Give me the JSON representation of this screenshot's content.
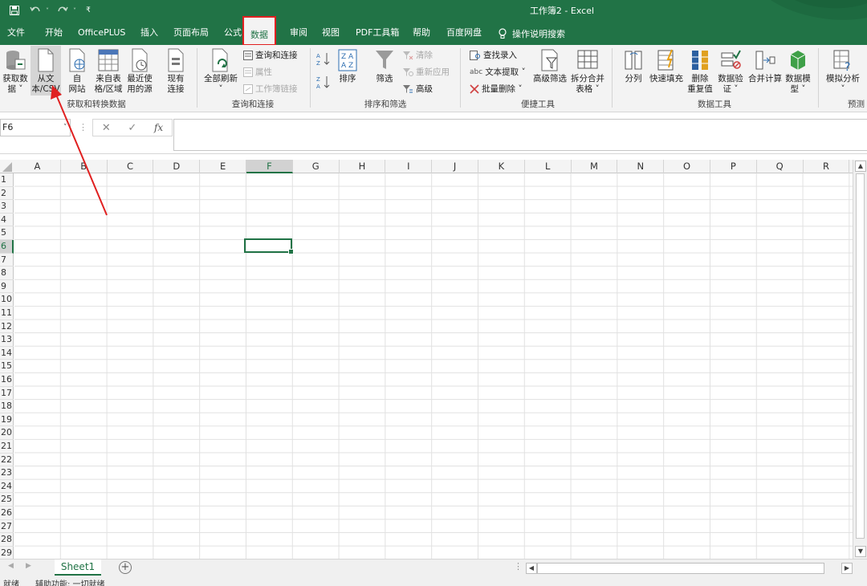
{
  "window": {
    "title": "工作簿2 - Excel",
    "accent": "#217346",
    "highlight": "#e02020"
  },
  "quick_access": [
    "save-icon",
    "undo-icon",
    "redo-icon",
    "customize-icon"
  ],
  "tabs": [
    {
      "label": "文件"
    },
    {
      "label": "开始"
    },
    {
      "label": "OfficePLUS"
    },
    {
      "label": "插入"
    },
    {
      "label": "页面布局"
    },
    {
      "label": "公式"
    },
    {
      "label": "数据",
      "active": true
    },
    {
      "label": "审阅"
    },
    {
      "label": "视图"
    },
    {
      "label": "PDF工具箱"
    },
    {
      "label": "帮助"
    },
    {
      "label": "百度网盘"
    }
  ],
  "tell_me": "操作说明搜索",
  "ribbon": {
    "get_transform": {
      "label": "获取和转换数据",
      "get_data": [
        "获取数",
        "据 ˅"
      ],
      "from_text": [
        "从文",
        "本/CSV"
      ],
      "from_web": [
        "自",
        "网站"
      ],
      "from_table": [
        "来自表",
        "格/区域"
      ],
      "recent": [
        "最近使",
        "用的源"
      ],
      "existing": [
        "现有",
        "连接"
      ]
    },
    "queries": {
      "label": "查询和连接",
      "refresh_all": [
        "全部刷新",
        "˅"
      ],
      "queries_connections": "查询和连接",
      "properties": "属性",
      "workbook_links": "工作簿链接"
    },
    "sort_filter": {
      "label": "排序和筛选",
      "sort": "排序",
      "filter": "筛选",
      "clear": "清除",
      "reapply": "重新应用",
      "advanced": "高级"
    },
    "quick_tools": {
      "label": "便捷工具",
      "find_entry": "查找录入",
      "text_extract": "文本提取 ˅",
      "batch_delete": "批量删除 ˅",
      "advanced_filter": "高级筛选",
      "split_merge": [
        "拆分合并",
        "表格 ˅"
      ]
    },
    "data_tools": {
      "label": "数据工具",
      "text_to_columns": "分列",
      "flash_fill": "快速填充",
      "remove_dup": [
        "删除",
        "重复值"
      ],
      "validation": [
        "数据验",
        "证 ˅"
      ],
      "consolidate": "合并计算",
      "data_model": [
        "数据模",
        "型 ˅"
      ]
    },
    "forecast": {
      "label": "预测",
      "what_if": [
        "模拟分析",
        "˅"
      ]
    }
  },
  "formula_bar": {
    "name_box": "F6",
    "fx": "fx",
    "value": ""
  },
  "columns": [
    "A",
    "B",
    "C",
    "D",
    "E",
    "F",
    "G",
    "H",
    "I",
    "J",
    "K",
    "L",
    "M",
    "N",
    "O",
    "P",
    "Q",
    "R"
  ],
  "rows": [
    "1",
    "2",
    "3",
    "4",
    "5",
    "6",
    "7",
    "8",
    "9",
    "10",
    "11",
    "12",
    "13",
    "14",
    "15",
    "16",
    "17",
    "18",
    "19",
    "20",
    "21",
    "22",
    "23",
    "24",
    "25",
    "26",
    "27",
    "28",
    "29"
  ],
  "selected": {
    "column": "F",
    "row": "6"
  },
  "sheets": [
    {
      "label": "Sheet1",
      "active": true
    }
  ],
  "status": {
    "ready": "就绪",
    "accessibility": "辅助功能: 一切就绪"
  }
}
